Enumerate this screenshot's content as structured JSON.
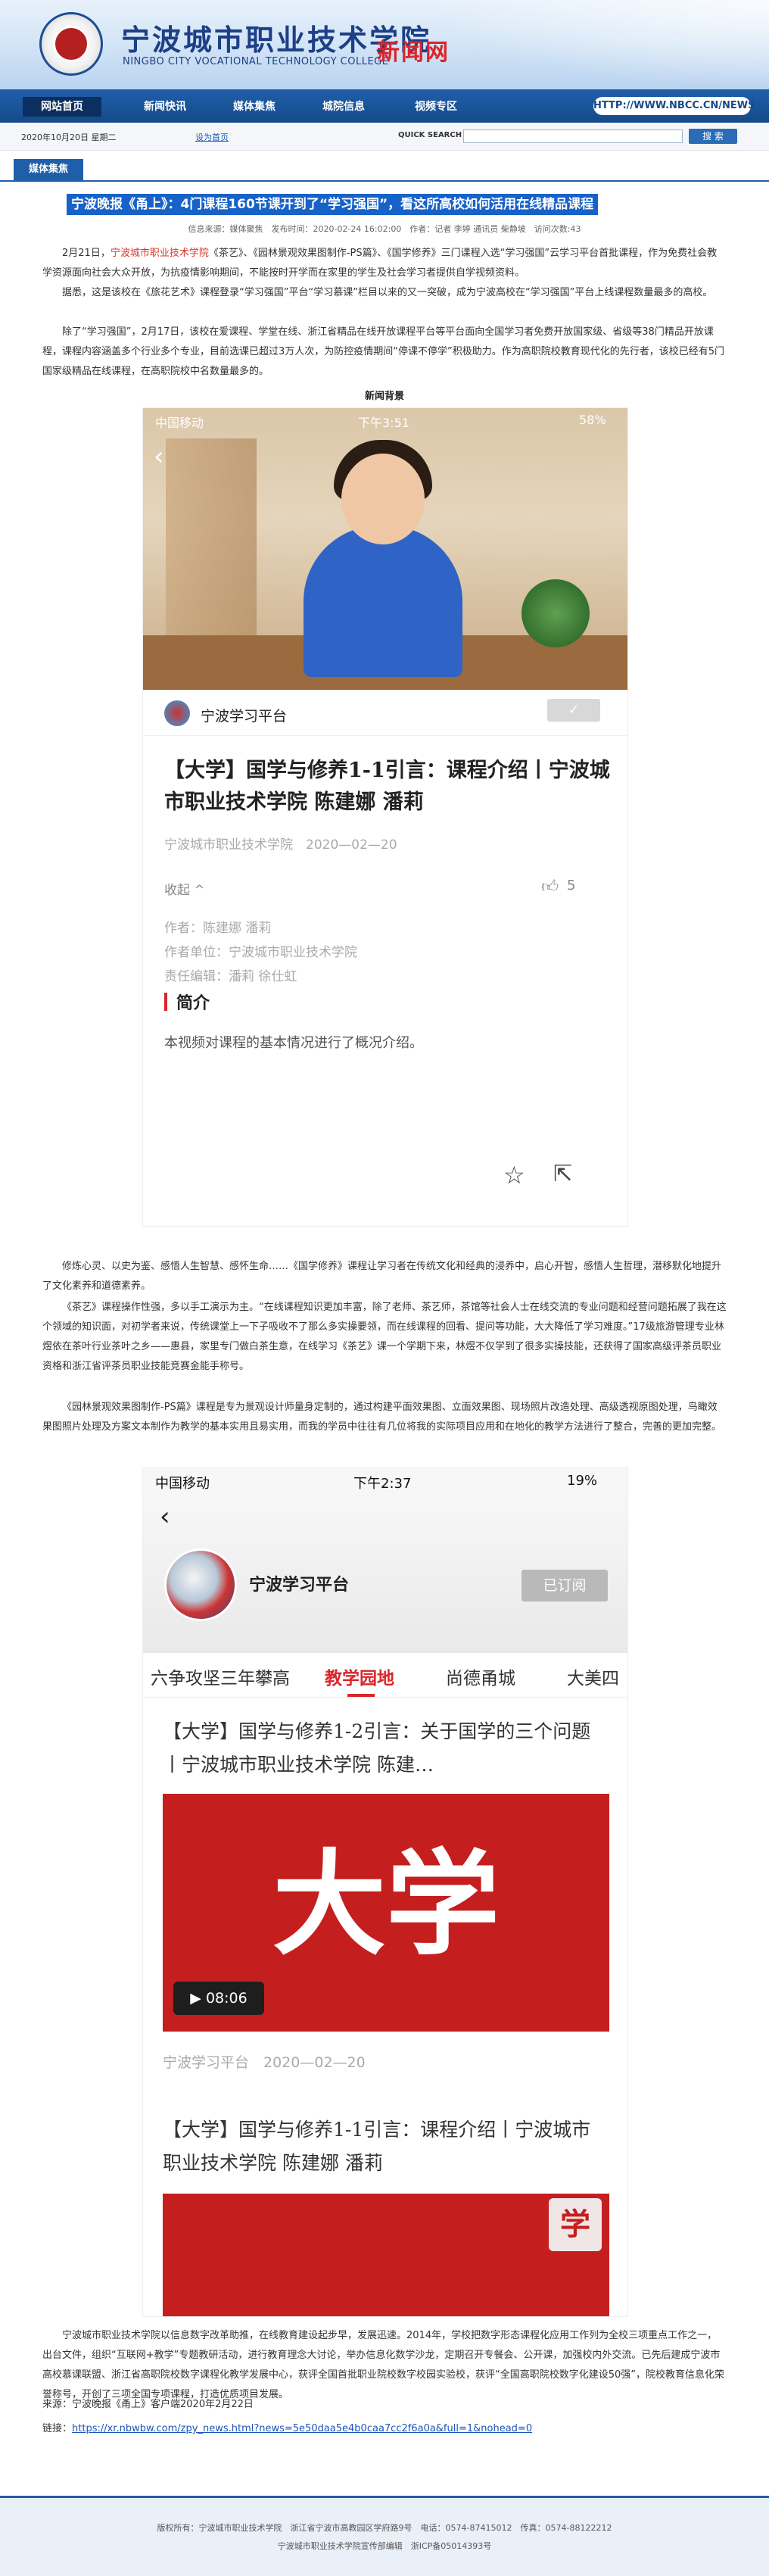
{
  "header": {
    "site_title": "宁波城市职业技术学院",
    "site_subtitle": "NINGBO CITY VOCATIONAL TECHNOLOGY COLLEGE",
    "news_net": "新闻网"
  },
  "nav": {
    "items": [
      "网站首页",
      "新闻快讯",
      "媒体集焦",
      "城院信息",
      "视频专区"
    ],
    "url_badge": "HTTP://WWW.NBCC.CN/NEWS"
  },
  "infobar": {
    "date": "2020年10月20日 星期二",
    "quick_link": "设为首页",
    "search_label": "QUICK SEARCH",
    "search_placeholder": "",
    "search_button": "搜 索"
  },
  "section_tab": "媒体集焦",
  "article": {
    "title": "宁波晚报《甬上》：4门课程160节课开到了“学习强国”，看这所高校如何活用在线精品课程",
    "meta": "信息来源：媒体聚焦　发布时间：2020-02-24 16:02:00　作者：记者 李婷 通讯员 柴静坡　访问次数:43",
    "p1_a": "2月21日，",
    "p1_highlight": "宁波城市职业技术学院",
    "p1_b": "《茶艺》、《园林景观效果图制作-PS篇》、《国学修养》三门课程入选“学习强国”云学习平台首批课程，作为免费社会教学资源面向社会大众开放，为抗疫情影响期间，不能按时开学而在家里的学生及社会学习者提供自学视频资料。",
    "p2": "据悉，这是该校在《旅花艺术》课程登录“学习强国”平台“学习慕课”栏目以来的又一突破，成为宁波高校在“学习强国”平台上线课程数量最多的高校。",
    "p3": "除了“学习强国”，2月17日，该校在爱课程、学堂在线、浙江省精品在线开放课程平台等平台面向全国学习者免费开放国家级、省级等38门精品开放课程，课程内容涵盖多个行业多个专业，目前选课已超过3万人次，为防控疫情期间“停课不停学”积极助力。作为高职院校教育现代化的先行者，该校已经有5门国家级精品在线课程，在高职院校中名数量最多的。",
    "caption": "新闻背景",
    "p4": "修炼心灵、以史为鉴、感悟人生智慧、感怀生命……《国学修养》课程让学习者在传统文化和经典的浸养中，启心开智，感悟人生哲理，潜移默化地提升了文化素养和道德素养。",
    "p5": "《茶艺》课程操作性强，多以手工演示为主。“在线课程知识更加丰富，除了老师、茶艺师，茶馆等社会人士在线交流的专业问题和经营问题拓展了我在这个领域的知识面，对初学者来说，传统课堂上一下子吸收不了那么多实操要领，而在线课程的回看、提问等功能，大大降低了学习难度。”17级旅游管理专业林煜依在茶叶行业茶叶之乡——惠县，家里专门做白茶生意，在线学习《茶艺》课一个学期下来，林煜不仅学到了很多实操技能，还获得了国家高级评茶员职业资格和浙江省评茶员职业技能竞赛金能手称号。",
    "p6": "《园林景观效果图制作-PS篇》课程是专为景观设计师量身定制的，通过构建平面效果图、立面效果图、现场照片改造处理、高级透视原图处理，鸟瞰效果图照片处理及方案文本制作为教学的基本实用且易实用，而我的学员中往往有几位将我的实际项目应用和在地化的教学方法进行了整合，完善的更加完整。",
    "p7": "宁波城市职业技术学院以信息数字改革助推，在线教育建设起步早，发展迅速。2014年，学校把数字形态课程化应用工作列为全校三项重点工作之一，出台文件，组织“互联网+教学”专题教研活动，进行教育理念大讨论，举办信息化数学沙龙，定期召开专餐会、公开课，加强校内外交流。已先后建成宁波市高校慕课联盟、浙江省高职院校数字课程化教学发展中心，获评全国首批职业院校数字校园实验校，获评“全国高职院校数字化建设50强”，院校教育信息化荣誉称号，开创了三项全国专项课程，打造优质项目发展。"
  },
  "shot1": {
    "status_carrier": "中国移动",
    "status_time": "下午3:51",
    "status_battery": "58%",
    "platform_name": "宁波学习平台",
    "heading": "【大学】国学与修养1-1引言：课程介绍丨宁波城市职业技术学院 陈建娜 潘莉",
    "source": "宁波城市职业技术学院　2020—02—20",
    "collapse": "收起 ^",
    "likes": "5",
    "author": "作者：陈建娜 潘莉",
    "org": "作者单位：宁波城市职业技术学院",
    "editor": "责任编辑：潘莉 徐仕虹",
    "intro_title": "简介",
    "intro_text": "本视频对课程的基本情况进行了概况介绍。"
  },
  "shot2": {
    "status_carrier": "中国移动",
    "status_time": "下午2:37",
    "status_battery": "19%",
    "platform_name": "宁波学习平台",
    "subscribed": "已订阅",
    "tabs": [
      "六争攻坚三年攀高",
      "教学园地",
      "尚德甬城",
      "大美四"
    ],
    "item1_title": "【大学】国学与修养1-2引言：关于国学的三个问题丨宁波城市职业技术学院 陈建…",
    "item1_bigtext": "大学",
    "item1_duration": "▶ 08:06",
    "item1_source": "宁波学习平台　2020—02—20",
    "item2_title": "【大学】国学与修养1-1引言：课程介绍丨宁波城市职业技术学院 陈建娜 潘莉",
    "item2_badge": "学"
  },
  "footer_source": {
    "source": "来源：宁波晚报《甬上》客户端2020年2月22日",
    "link_label": "链接：",
    "link_url": "https://xr.nbwbw.com/zpy_news.html?news=5e50daa5e4b0caa7cc2f6a0a&full=1&nohead=0"
  },
  "footer": {
    "line1": "版权所有：宁波城市职业技术学院　浙江省宁波市高教园区学府路9号　电话：0574-87415012　传真：0574-88122212",
    "line2": "宁波城市职业技术学院宣传部编辑　浙ICP备05014393号"
  }
}
